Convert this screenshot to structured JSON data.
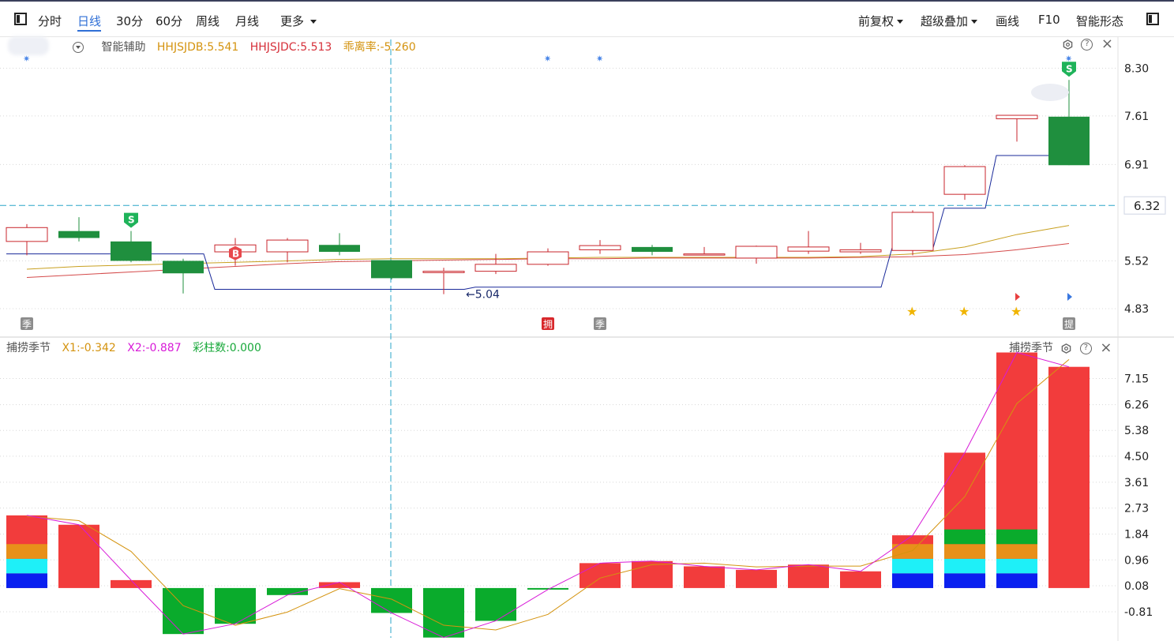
{
  "toolbar": {
    "left_tabs": [
      "分时",
      "日线",
      "30分",
      "60分",
      "周线",
      "月线"
    ],
    "active_tab": "日线",
    "more": "更多",
    "right_items": [
      "前复权",
      "超级叠加",
      "画线",
      "F10",
      "智能形态"
    ]
  },
  "upper_legend": {
    "title": "智能辅助",
    "items": [
      {
        "text": "HHJSJDB:5.541",
        "color": "#d4930f"
      },
      {
        "text": "HHJSJDC:5.513",
        "color": "#d6303a"
      },
      {
        "text": "乖离率:-5.260",
        "color": "#d4930f"
      }
    ]
  },
  "lower_legend": {
    "title": "捕捞季节",
    "items": [
      {
        "text": "X1:-0.342",
        "color": "#d4930f"
      },
      {
        "text": "X2:-0.887",
        "color": "#d81ad8"
      },
      {
        "text": "彩柱数:0.000",
        "color": "#18a83a"
      }
    ]
  },
  "lower_panel_label": "捕捞季节",
  "colors": {
    "up": "#c8262c",
    "down": "#1f8f3e",
    "blue_line": "#1a2a9a",
    "yellow_line": "#c8a020",
    "red_line": "#d44a4a",
    "dash": "#2aa6c8",
    "bar_red": "#f23c3c",
    "bar_green": "#0aab2c",
    "bar_orange": "#e8901a",
    "bar_cyan": "#1ef0f8",
    "bar_blue": "#0a20f0",
    "x1": "#d4930f",
    "x2": "#d81ad8"
  },
  "chart_data": [
    {
      "type": "candlestick",
      "y_ticks": [
        "8.30",
        "7.61",
        "6.91",
        "5.52",
        "4.83"
      ],
      "ylim": [
        4.5,
        8.6
      ],
      "current_price": "6.32",
      "low_label": "5.04",
      "candles": [
        {
          "o": 5.8,
          "h": 6.05,
          "l": 5.6,
          "c": 6.0
        },
        {
          "o": 5.95,
          "h": 6.15,
          "l": 5.8,
          "c": 5.85
        },
        {
          "o": 5.8,
          "h": 5.95,
          "l": 5.5,
          "c": 5.52
        },
        {
          "o": 5.52,
          "h": 5.55,
          "l": 5.05,
          "c": 5.34
        },
        {
          "o": 5.65,
          "h": 5.85,
          "l": 5.45,
          "c": 5.75
        },
        {
          "o": 5.65,
          "h": 5.85,
          "l": 5.5,
          "c": 5.82
        },
        {
          "o": 5.75,
          "h": 5.92,
          "l": 5.6,
          "c": 5.65
        },
        {
          "o": 5.53,
          "h": 5.53,
          "l": 5.25,
          "c": 5.27
        },
        {
          "o": 5.35,
          "h": 5.42,
          "l": 5.04,
          "c": 5.37
        },
        {
          "o": 5.37,
          "h": 5.62,
          "l": 5.33,
          "c": 5.47
        },
        {
          "o": 5.47,
          "h": 5.7,
          "l": 5.45,
          "c": 5.65
        },
        {
          "o": 5.68,
          "h": 5.82,
          "l": 5.62,
          "c": 5.74
        },
        {
          "o": 5.72,
          "h": 5.75,
          "l": 5.6,
          "c": 5.65
        },
        {
          "o": 5.62,
          "h": 5.72,
          "l": 5.62,
          "c": 5.62
        },
        {
          "o": 5.56,
          "h": 5.74,
          "l": 5.48,
          "c": 5.73
        },
        {
          "o": 5.66,
          "h": 5.95,
          "l": 5.62,
          "c": 5.72
        },
        {
          "o": 5.65,
          "h": 5.78,
          "l": 5.62,
          "c": 5.68
        },
        {
          "o": 5.67,
          "h": 6.25,
          "l": 5.6,
          "c": 6.22
        },
        {
          "o": 6.48,
          "h": 6.9,
          "l": 6.4,
          "c": 6.88
        },
        {
          "o": 7.57,
          "h": 7.62,
          "l": 7.24,
          "c": 7.62
        },
        {
          "o": 7.6,
          "h": 8.13,
          "l": 6.9,
          "c": 6.9
        }
      ],
      "line_blue": [
        5.62,
        5.62,
        5.62,
        5.62,
        5.11,
        5.11,
        5.11,
        5.11,
        5.11,
        5.14,
        5.14,
        5.14,
        5.14,
        5.14,
        5.14,
        5.14,
        5.14,
        5.71,
        6.28,
        7.04,
        7.04
      ],
      "line_yellow": [
        5.4,
        5.44,
        5.46,
        5.48,
        5.5,
        5.52,
        5.54,
        5.55,
        5.55,
        5.55,
        5.56,
        5.57,
        5.57,
        5.57,
        5.57,
        5.57,
        5.58,
        5.62,
        5.72,
        5.9,
        6.03
      ],
      "line_red": [
        5.28,
        5.32,
        5.36,
        5.4,
        5.44,
        5.48,
        5.51,
        5.52,
        5.53,
        5.54,
        5.55,
        5.55,
        5.56,
        5.56,
        5.56,
        5.56,
        5.57,
        5.58,
        5.61,
        5.68,
        5.77
      ],
      "buy_signal_index": 4,
      "sell_signal_indices": [
        2,
        20
      ],
      "star_indices": [
        17,
        18,
        19
      ],
      "bottom_badges": [
        {
          "index": 0,
          "text": "季",
          "kind": "gray"
        },
        {
          "index": 10,
          "text": "拥",
          "kind": "red"
        },
        {
          "index": 11,
          "text": "季",
          "kind": "gray"
        },
        {
          "index": 20,
          "text": "提",
          "kind": "gray"
        }
      ],
      "top_star_indices": [
        0,
        10,
        11,
        20
      ]
    },
    {
      "type": "bar",
      "y_ticks": [
        "7.15",
        "6.26",
        "5.38",
        "4.50",
        "3.61",
        "2.73",
        "1.84",
        "0.96",
        "0.08",
        "-0.81"
      ],
      "ylim": [
        -1.7,
        8.0
      ],
      "bars": [
        {
          "v": 2.48,
          "colored": true
        },
        {
          "v": 2.16,
          "colored": false
        },
        {
          "v": 0.27,
          "colored": false
        },
        {
          "v": -1.57,
          "colored": false
        },
        {
          "v": -1.22,
          "colored": false
        },
        {
          "v": -0.24,
          "colored": false
        },
        {
          "v": 0.2,
          "colored": false
        },
        {
          "v": -0.85,
          "colored": false
        },
        {
          "v": -1.69,
          "colored": false
        },
        {
          "v": -1.12,
          "colored": false
        },
        {
          "v": -0.05,
          "colored": false
        },
        {
          "v": 0.85,
          "colored": false
        },
        {
          "v": 0.92,
          "colored": false
        },
        {
          "v": 0.74,
          "colored": false
        },
        {
          "v": 0.62,
          "colored": false
        },
        {
          "v": 0.8,
          "colored": false
        },
        {
          "v": 0.57,
          "colored": false
        },
        {
          "v": 1.8,
          "colored": true
        },
        {
          "v": 4.62,
          "colored": true
        },
        {
          "v": 8.04,
          "colored": true
        },
        {
          "v": 7.55,
          "colored": false
        }
      ],
      "x1": [
        2.45,
        2.3,
        1.25,
        -0.6,
        -1.27,
        -0.82,
        -0.02,
        -0.38,
        -1.27,
        -1.43,
        -0.9,
        0.34,
        0.8,
        0.85,
        0.72,
        0.75,
        0.75,
        1.28,
        3.12,
        6.3,
        7.8
      ],
      "x2": [
        2.48,
        2.16,
        0.27,
        -1.57,
        -1.22,
        -0.24,
        0.2,
        -0.85,
        -1.69,
        -1.12,
        -0.05,
        0.85,
        0.92,
        0.74,
        0.62,
        0.8,
        0.57,
        1.8,
        4.62,
        8.04,
        7.55
      ]
    }
  ]
}
